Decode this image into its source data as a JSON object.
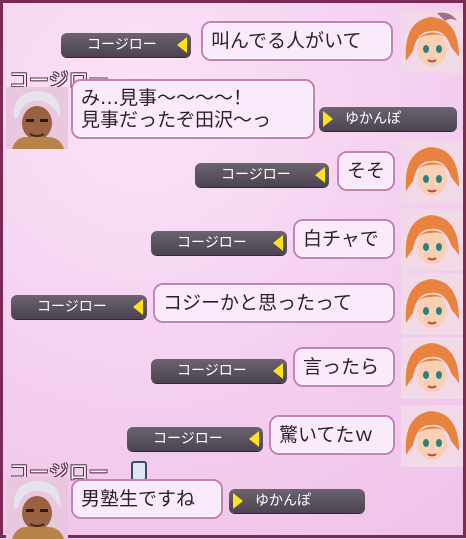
{
  "messages": [
    {
      "name": "コージロー",
      "text": "叫んでる人がいて"
    },
    {
      "name": "ゆかんぽ",
      "speaker": "コージロー",
      "text_line1": "み…見事〜〜〜〜！",
      "text_line2": "見事だったぞ田沢〜っ"
    },
    {
      "name": "コージロー",
      "text": "そそ"
    },
    {
      "name": "コージロー",
      "text": "白チャで"
    },
    {
      "name": "コージロー",
      "text": "コジーかと思ったって"
    },
    {
      "name": "コージロー",
      "text": "言ったら"
    },
    {
      "name": "コージロー",
      "text": "驚いてたｗ"
    },
    {
      "name": "ゆかんぽ",
      "speaker": "コージロー",
      "text": "男塾生ですね"
    }
  ],
  "icons": {
    "female_avatar": "orange-haired-girl-avatar-icon",
    "male_avatar": "white-haired-man-avatar-icon",
    "tag_arrow": "yellow-triangle-icon",
    "phone": "smartphone-icon"
  },
  "colors": {
    "bubble": "#fbeafb",
    "border": "#c77fb7",
    "tag": "#4b4350",
    "arrow": "#ffe21a"
  }
}
